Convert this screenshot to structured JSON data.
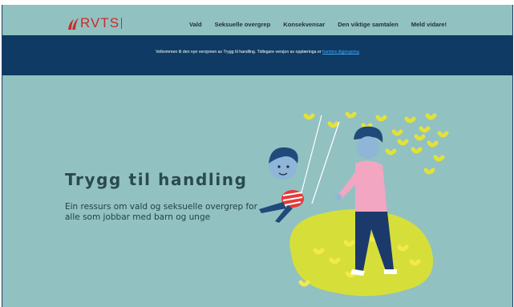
{
  "header": {
    "logo_text": "RVTS",
    "nav": [
      "Vald",
      "Seksuelle overgrep",
      "Konsekvensar",
      "Den viktige samtalen",
      "Meld vidare!"
    ]
  },
  "banner": {
    "text": "Velkommen til den nye versjonen av Trygg til handling. Tidlegare versjon av opplæringa er ",
    "link_text": "framleis tilgjengeleg"
  },
  "hero": {
    "title": "Trygg til handling",
    "subtitle": "Ein ressurs om vald og seksuelle overgrep for alle som jobbar med barn og unge"
  },
  "colors": {
    "background": "#92c1c1",
    "banner": "#0e3a63",
    "brand_red": "#c92b27",
    "link": "#3fa9f5"
  }
}
